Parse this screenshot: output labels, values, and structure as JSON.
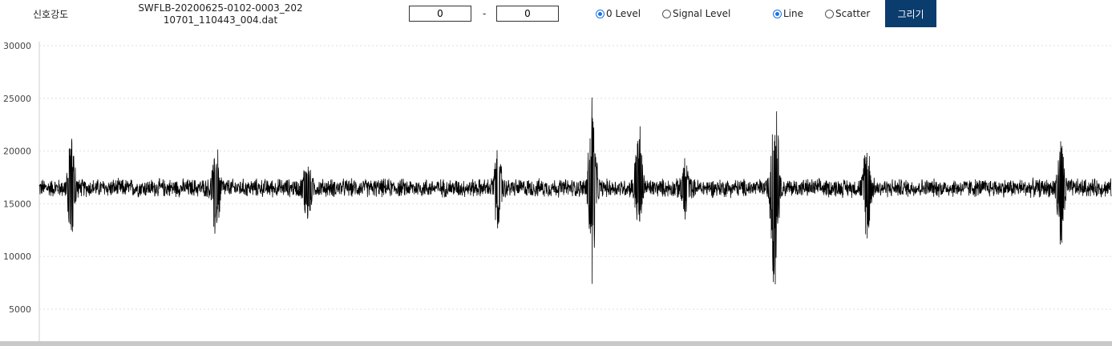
{
  "header": {
    "title": "신호강도",
    "filename": "SWFLB-20200625-0102-0003_20210701_110443_004.dat",
    "range_start": "0",
    "range_separator": "-",
    "range_end": "0",
    "baseline_options": [
      {
        "label": "0 Level",
        "selected": true
      },
      {
        "label": "Signal Level",
        "selected": false
      }
    ],
    "plot_options": [
      {
        "label": "Line",
        "selected": true
      },
      {
        "label": "Scatter",
        "selected": false
      }
    ],
    "draw_button": "그리기"
  },
  "chart_data": {
    "type": "line",
    "title": "",
    "xlabel": "",
    "ylabel": "",
    "ylim": [
      0,
      30000
    ],
    "yticks": [
      5000,
      10000,
      15000,
      20000,
      25000,
      30000
    ],
    "grid": true,
    "series_color": "#000000",
    "baseline": 16500,
    "noise_amplitude": 1000,
    "bursts": [
      {
        "x": 0.03,
        "max": 21400,
        "min": 11700
      },
      {
        "x": 0.165,
        "max": 20900,
        "min": 11500
      },
      {
        "x": 0.25,
        "max": 20100,
        "min": 12000
      },
      {
        "x": 0.428,
        "max": 20300,
        "min": 12000
      },
      {
        "x": 0.516,
        "max": 25200,
        "min": 7000
      },
      {
        "x": 0.559,
        "max": 23500,
        "min": 12300
      },
      {
        "x": 0.602,
        "max": 19500,
        "min": 13300
      },
      {
        "x": 0.686,
        "max": 26900,
        "min": 6800
      },
      {
        "x": 0.772,
        "max": 21100,
        "min": 11600
      },
      {
        "x": 0.953,
        "max": 21000,
        "min": 10800
      }
    ]
  }
}
